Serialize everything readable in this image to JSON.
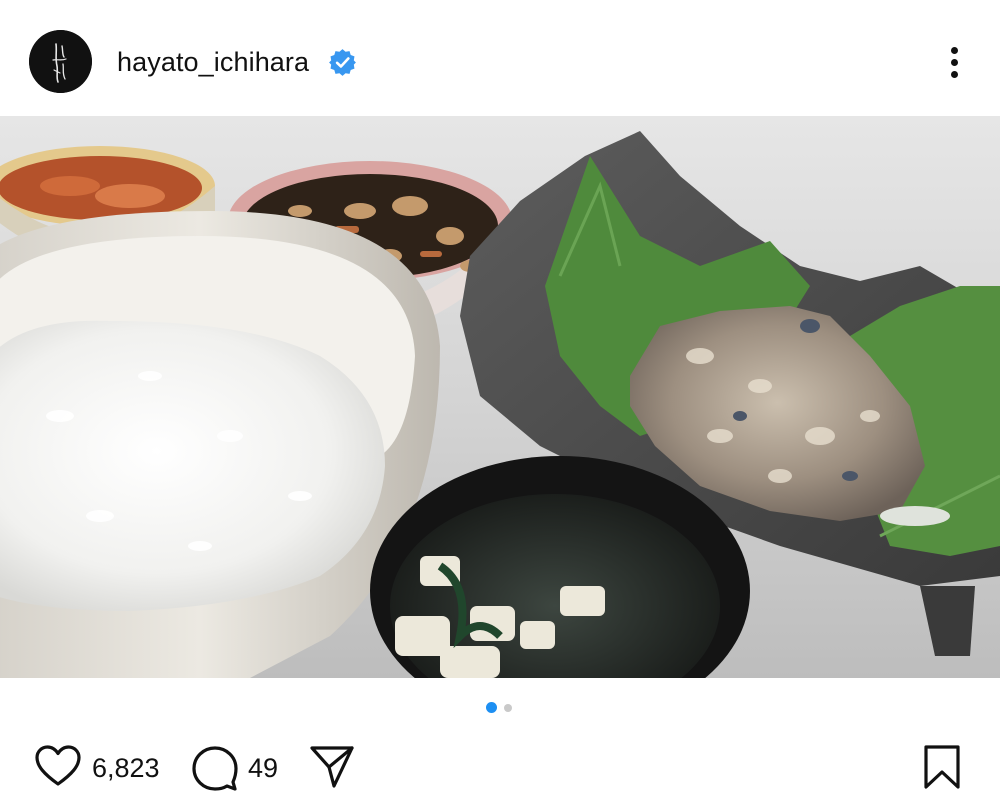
{
  "post": {
    "username": "hayato_ichihara",
    "verified": true,
    "avatar_icon": "calligraphy-logo-avatar",
    "more_icon": "more-vertical-icon"
  },
  "photo": {
    "subject": "photo"
  },
  "carousel": {
    "current": 1,
    "total": 2,
    "active_color": "#1d8ff2",
    "inactive_color": "#c9c9c9"
  },
  "actions": {
    "likes": "6,823",
    "comments": "49",
    "like_icon": "heart-icon",
    "comment_icon": "comment-bubble-icon",
    "share_icon": "paper-plane-icon",
    "save_icon": "bookmark-icon"
  },
  "colors": {
    "verified_badge": "#3897f0",
    "text": "#111111"
  }
}
